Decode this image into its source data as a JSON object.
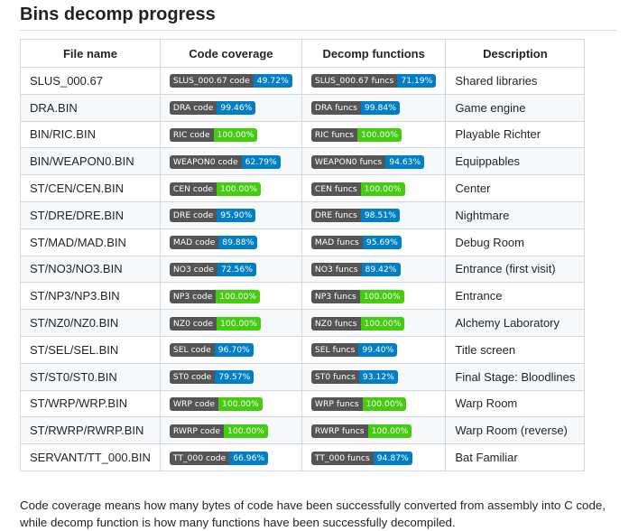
{
  "title": "Bins decomp progress",
  "headers": [
    "File name",
    "Code coverage",
    "Decomp functions",
    "Description"
  ],
  "rows": [
    {
      "file": "SLUS_000.67",
      "code_label": "SLUS_000.67 code",
      "code_value": "49.72%",
      "code_color": "#007ec6",
      "funcs_label": "SLUS_000.67 funcs",
      "funcs_value": "71.19%",
      "funcs_color": "#007ec6",
      "desc": "Shared libraries"
    },
    {
      "file": "DRA.BIN",
      "code_label": "DRA code",
      "code_value": "99.46%",
      "code_color": "#007ec6",
      "funcs_label": "DRA funcs",
      "funcs_value": "99.84%",
      "funcs_color": "#007ec6",
      "desc": "Game engine"
    },
    {
      "file": "BIN/RIC.BIN",
      "code_label": "RIC code",
      "code_value": "100.00%",
      "code_color": "#4c1",
      "funcs_label": "RIC funcs",
      "funcs_value": "100.00%",
      "funcs_color": "#4c1",
      "desc": "Playable Richter"
    },
    {
      "file": "BIN/WEAPON0.BIN",
      "code_label": "WEAPON0 code",
      "code_value": "62.79%",
      "code_color": "#007ec6",
      "funcs_label": "WEAPON0 funcs",
      "funcs_value": "94.63%",
      "funcs_color": "#007ec6",
      "desc": "Equippables"
    },
    {
      "file": "ST/CEN/CEN.BIN",
      "code_label": "CEN code",
      "code_value": "100.00%",
      "code_color": "#4c1",
      "funcs_label": "CEN funcs",
      "funcs_value": "100.00%",
      "funcs_color": "#4c1",
      "desc": "Center"
    },
    {
      "file": "ST/DRE/DRE.BIN",
      "code_label": "DRE code",
      "code_value": "95.90%",
      "code_color": "#007ec6",
      "funcs_label": "DRE funcs",
      "funcs_value": "98.51%",
      "funcs_color": "#007ec6",
      "desc": "Nightmare"
    },
    {
      "file": "ST/MAD/MAD.BIN",
      "code_label": "MAD code",
      "code_value": "89.88%",
      "code_color": "#007ec6",
      "funcs_label": "MAD funcs",
      "funcs_value": "95.69%",
      "funcs_color": "#007ec6",
      "desc": "Debug Room"
    },
    {
      "file": "ST/NO3/NO3.BIN",
      "code_label": "NO3 code",
      "code_value": "72.56%",
      "code_color": "#007ec6",
      "funcs_label": "NO3 funcs",
      "funcs_value": "89.42%",
      "funcs_color": "#007ec6",
      "desc": "Entrance (first visit)"
    },
    {
      "file": "ST/NP3/NP3.BIN",
      "code_label": "NP3 code",
      "code_value": "100.00%",
      "code_color": "#4c1",
      "funcs_label": "NP3 funcs",
      "funcs_value": "100.00%",
      "funcs_color": "#4c1",
      "desc": "Entrance"
    },
    {
      "file": "ST/NZ0/NZ0.BIN",
      "code_label": "NZ0 code",
      "code_value": "100.00%",
      "code_color": "#4c1",
      "funcs_label": "NZ0 funcs",
      "funcs_value": "100.00%",
      "funcs_color": "#4c1",
      "desc": "Alchemy Laboratory"
    },
    {
      "file": "ST/SEL/SEL.BIN",
      "code_label": "SEL code",
      "code_value": "96.70%",
      "code_color": "#007ec6",
      "funcs_label": "SEL funcs",
      "funcs_value": "99.40%",
      "funcs_color": "#007ec6",
      "desc": "Title screen"
    },
    {
      "file": "ST/ST0/ST0.BIN",
      "code_label": "ST0 code",
      "code_value": "79.57%",
      "code_color": "#007ec6",
      "funcs_label": "ST0 funcs",
      "funcs_value": "93.12%",
      "funcs_color": "#007ec6",
      "desc": "Final Stage: Bloodlines"
    },
    {
      "file": "ST/WRP/WRP.BIN",
      "code_label": "WRP code",
      "code_value": "100.00%",
      "code_color": "#4c1",
      "funcs_label": "WRP funcs",
      "funcs_value": "100.00%",
      "funcs_color": "#4c1",
      "desc": "Warp Room"
    },
    {
      "file": "ST/RWRP/RWRP.BIN",
      "code_label": "RWRP code",
      "code_value": "100.00%",
      "code_color": "#4c1",
      "funcs_label": "RWRP funcs",
      "funcs_value": "100.00%",
      "funcs_color": "#4c1",
      "desc": "Warp Room (reverse)"
    },
    {
      "file": "SERVANT/TT_000.BIN",
      "code_label": "TT_000 code",
      "code_value": "66.96%",
      "code_color": "#007ec6",
      "funcs_label": "TT_000 funcs",
      "funcs_value": "94.87%",
      "funcs_color": "#007ec6",
      "desc": "Bat Familiar"
    }
  ],
  "footer": "Code coverage means how many bytes of code have been successfully converted from assembly into C code, while decomp function is how many functions have been successfully decompiled."
}
